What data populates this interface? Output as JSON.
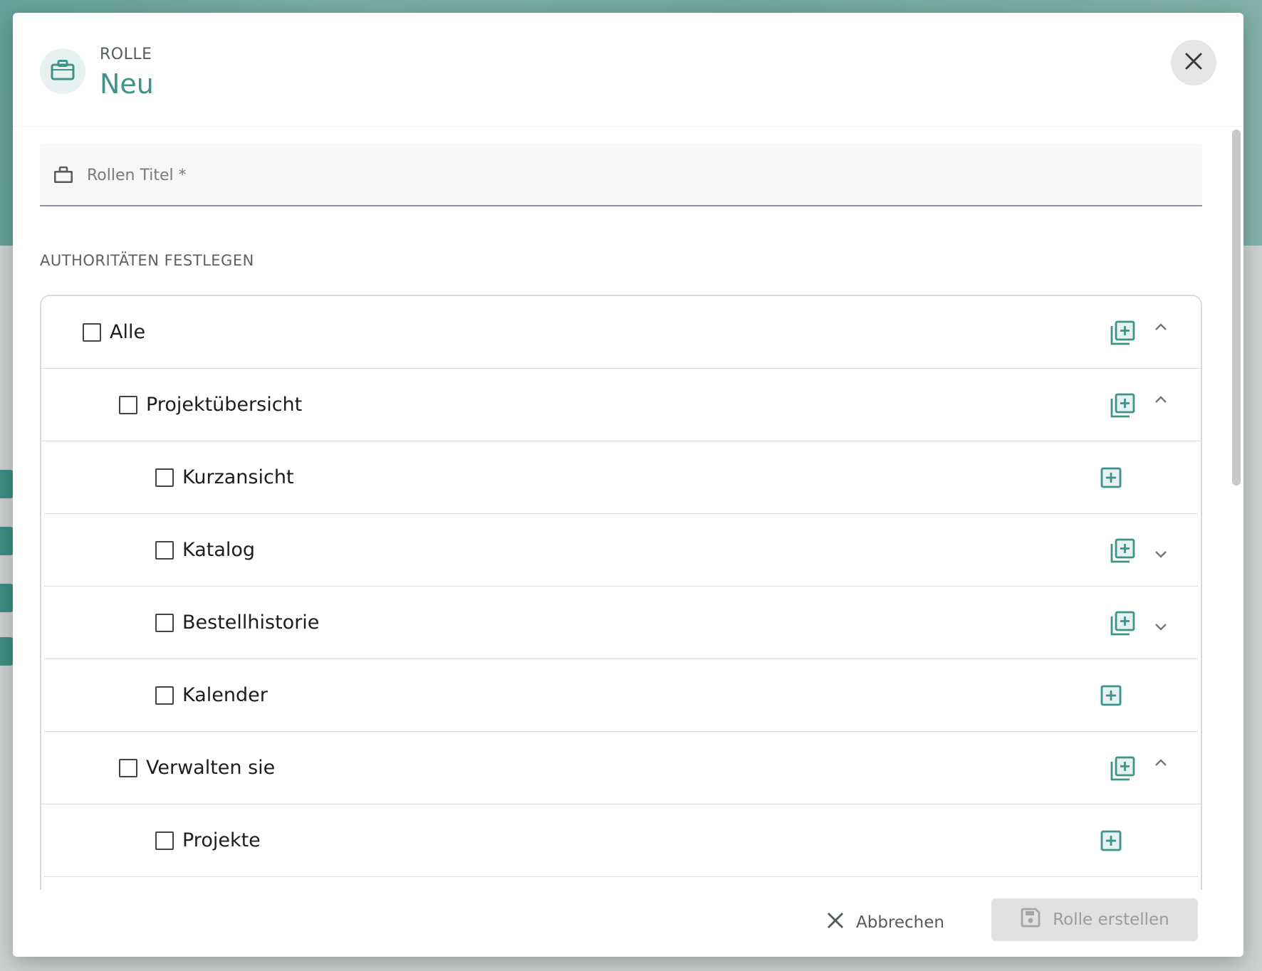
{
  "dialog": {
    "overline": "ROLLE",
    "title": "Neu",
    "close_icon": "close-icon"
  },
  "title_field": {
    "placeholder": "Rollen Titel *",
    "value": "",
    "icon": "briefcase-icon"
  },
  "section_label": "AUTHORITÄTEN FESTLEGEN",
  "tree": {
    "rows": [
      {
        "label": "Alle",
        "level": 0,
        "checked": false,
        "action_icon": "add-multiple-icon",
        "expand": "chevron-up-icon"
      },
      {
        "label": "Projektübersicht",
        "level": 1,
        "checked": false,
        "action_icon": "add-multiple-icon",
        "expand": "chevron-up-icon"
      },
      {
        "label": "Kurzansicht",
        "level": 2,
        "checked": false,
        "action_icon": "add-box-icon",
        "expand": ""
      },
      {
        "label": "Katalog",
        "level": 2,
        "checked": false,
        "action_icon": "add-multiple-icon",
        "expand": "chevron-down-icon"
      },
      {
        "label": "Bestellhistorie",
        "level": 2,
        "checked": false,
        "action_icon": "add-multiple-icon",
        "expand": "chevron-down-icon"
      },
      {
        "label": "Kalender",
        "level": 2,
        "checked": false,
        "action_icon": "add-box-icon",
        "expand": ""
      },
      {
        "label": "Verwalten sie",
        "level": 1,
        "checked": false,
        "action_icon": "add-multiple-icon",
        "expand": "chevron-up-icon"
      },
      {
        "label": "Projekte",
        "level": 2,
        "checked": false,
        "action_icon": "add-box-icon",
        "expand": ""
      }
    ]
  },
  "footer": {
    "cancel_label": "Abbrechen",
    "create_label": "Rolle erstellen"
  },
  "colors": {
    "accent": "#3d9487",
    "accent_light": "#e7f1ef",
    "disabled_bg": "#e1e1e1",
    "disabled_text": "#9c9c9c"
  }
}
